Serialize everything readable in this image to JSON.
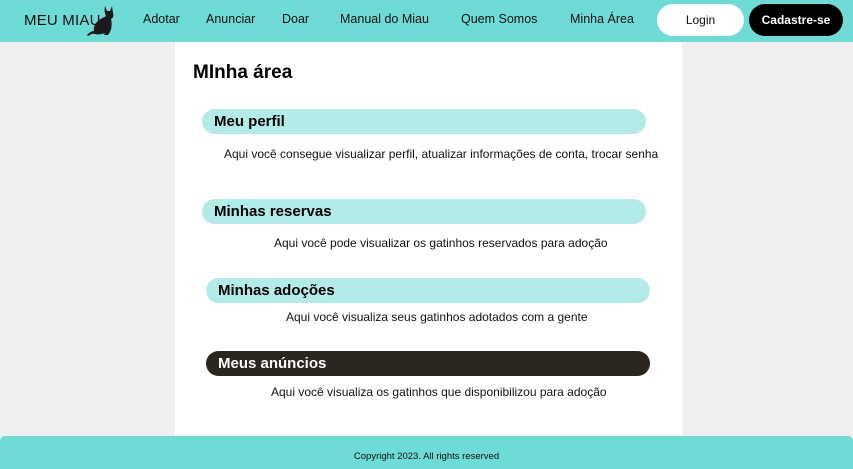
{
  "header": {
    "brand": "MEU MIAU",
    "logo_icon": "cat-icon",
    "nav": {
      "adotar": "Adotar",
      "anunciar": "Anunciar",
      "doar": "Doar",
      "manual": "Manual do Miau",
      "quem_somos": "Quem Somos",
      "minha_area": "Minha Área"
    },
    "login_label": "Login",
    "signup_label": "Cadastre-se"
  },
  "main": {
    "title": "MInha área",
    "sections": [
      {
        "title": "Meu perfil",
        "description": "Aqui você consegue visualizar perfil, atualizar informações de conta, trocar senha"
      },
      {
        "title": "Minhas reservas",
        "description": "Aqui você pode visualizar os gatinhos reservados para adoção"
      },
      {
        "title": "Minhas adoções",
        "description": "Aqui você visualiza seus gatinhos adotados com a gente"
      },
      {
        "title": "Meus anúncios",
        "description": "Aqui você visualiza os gatinhos que disponibilizou para adoção"
      }
    ]
  },
  "footer": {
    "copyright": "Copyright 2023. All rights reserved"
  },
  "colors": {
    "accent": "#6fdbd6",
    "section_pill": "#b2ebe8",
    "section_pill_active": "#2b2620",
    "page_background": "#efefef"
  }
}
